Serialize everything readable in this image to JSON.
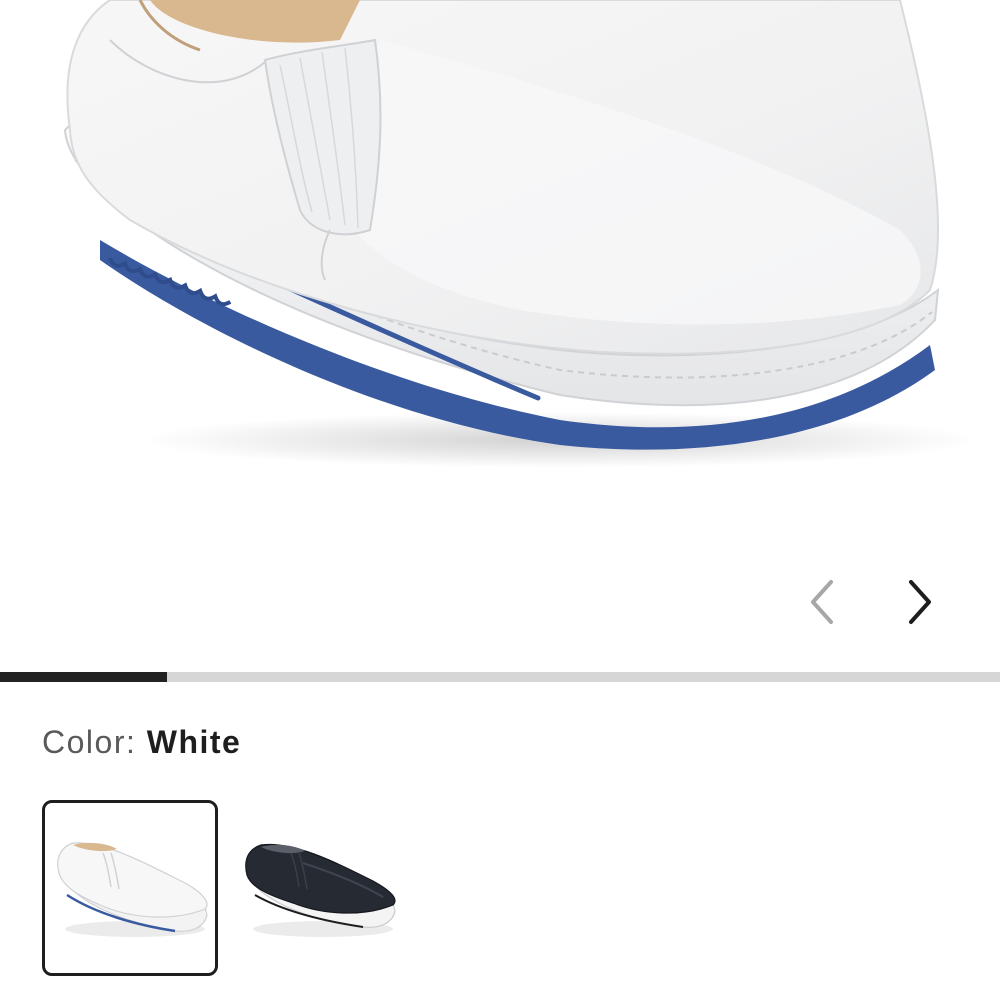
{
  "product": {
    "image_icon": "white-slip-on-shoe-image"
  },
  "carousel": {
    "prev_icon": "chevron-left-icon",
    "next_icon": "chevron-right-icon",
    "progress": 0.167,
    "progress_color": "#222222",
    "track_color": "#d6d6d6"
  },
  "color_selector": {
    "label": "Color:",
    "selected_value": "White",
    "swatches": [
      {
        "icon": "white-shoe-thumbnail",
        "selected": true
      },
      {
        "icon": "black-shoe-thumbnail",
        "selected": false
      }
    ]
  },
  "colors": {
    "sole_accent": "#3a5aa0",
    "selected_border": "#1e1e1e"
  }
}
